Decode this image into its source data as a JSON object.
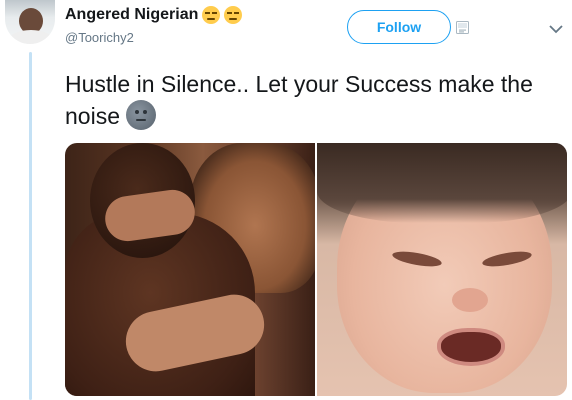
{
  "user": {
    "display_name": "Angered Nigerian",
    "handle": "@Toorichy2",
    "name_emojis": [
      "unamused-face-icon",
      "unamused-face-icon"
    ]
  },
  "header": {
    "follow_label": "Follow",
    "add_user_icon": "add-user-icon",
    "menu_icon": "chevron-down-icon"
  },
  "tweet": {
    "text": "Hustle in Silence..  Let your Success make the noise",
    "trailing_emoji": "new-moon-face-icon"
  },
  "media": {
    "photos": [
      "couple-hugging-photo",
      "crying-baby-photo"
    ]
  },
  "colors": {
    "accent": "#1da1f2",
    "thread_line": "#c4e1f5",
    "text_primary": "#14171a",
    "text_secondary": "#657786"
  }
}
